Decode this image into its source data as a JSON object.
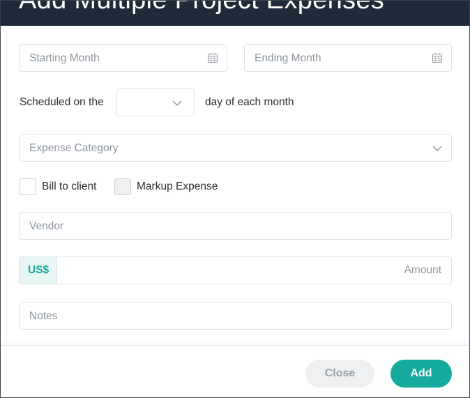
{
  "header": {
    "title": "Add Multiple Project Expenses"
  },
  "form": {
    "starting_month": {
      "placeholder": "Starting Month",
      "icon": "calendar-icon"
    },
    "ending_month": {
      "placeholder": "Ending Month",
      "icon": "calendar-icon"
    },
    "schedule": {
      "prefix_label": "Scheduled on the",
      "day_value": "",
      "suffix_label": "day of each month"
    },
    "expense_category": {
      "placeholder": "Expense Category"
    },
    "bill_to_client": {
      "label": "Bill to client",
      "checked": false
    },
    "markup_expense": {
      "label": "Markup Expense",
      "checked": false,
      "disabled": true
    },
    "vendor": {
      "placeholder": "Vendor"
    },
    "amount": {
      "currency": "US$",
      "placeholder": "Amount"
    },
    "notes": {
      "placeholder": "Notes"
    }
  },
  "footer": {
    "close_label": "Close",
    "add_label": "Add"
  },
  "colors": {
    "accent": "#16a99d",
    "header_bg": "#1f2b38",
    "prefix_bg": "#e6f6f5"
  }
}
